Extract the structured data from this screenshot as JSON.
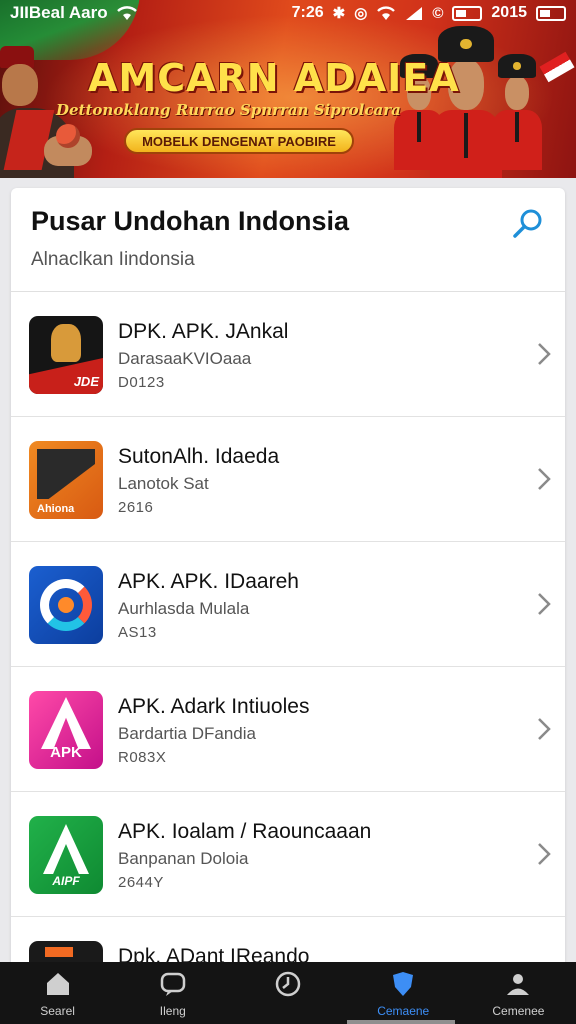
{
  "status_bar": {
    "carrier": "JIIBeal Aaro",
    "time": "7:26",
    "battery": "2015"
  },
  "banner": {
    "title": "AMCARN ADAIEA",
    "subtitle": "Dettonoklang Rurrao Spnrran Siprolcara",
    "pill": "MOBELK DENGENAT PAOBIRE"
  },
  "header": {
    "title": "Pusar Undohan Indonsia",
    "subtitle": "Alnaclkan Iindonsia"
  },
  "apps": [
    {
      "title": "DPK. APK. JAnkal",
      "subtitle": "DarasaaKVIOaaa",
      "meta": "D0123",
      "icon": "warrior-icon",
      "icon_text": "JDE"
    },
    {
      "title": "SutonAlh. Idaeda",
      "subtitle": "Lanotok Sat",
      "meta": "2616",
      "icon": "orange-grid-icon",
      "icon_text": "Ahiona"
    },
    {
      "title": "APK. APK. IDaareh",
      "subtitle": "Aurhlasda Mulala",
      "meta": "AS13",
      "icon": "blue-swirl-icon",
      "icon_text": ""
    },
    {
      "title": "APK. Adark Intiuoles",
      "subtitle": "Bardartia DFandia",
      "meta": "R083X",
      "icon": "pink-a-icon",
      "icon_text": "APK"
    },
    {
      "title": "APK. Ioalam / Raouncaaan",
      "subtitle": "Banpanan Doloia",
      "meta": "2644Y",
      "icon": "green-a-icon",
      "icon_text": "AIPF"
    },
    {
      "title": "Dpk. ADant IReando",
      "subtitle": "",
      "meta": "",
      "icon": "dark-app-icon",
      "icon_text": ""
    }
  ],
  "nav": [
    {
      "label": "Searel",
      "icon": "home-icon"
    },
    {
      "label": "Ileng",
      "icon": "chat-icon"
    },
    {
      "label": "",
      "icon": "clock-icon"
    },
    {
      "label": "Cemaene",
      "icon": "shield-icon"
    },
    {
      "label": "Cemenee",
      "icon": "profile-icon"
    }
  ],
  "colors": {
    "accent_blue": "#3d8ef5",
    "banner_red": "#d0311a",
    "nav_bg": "#141414"
  }
}
